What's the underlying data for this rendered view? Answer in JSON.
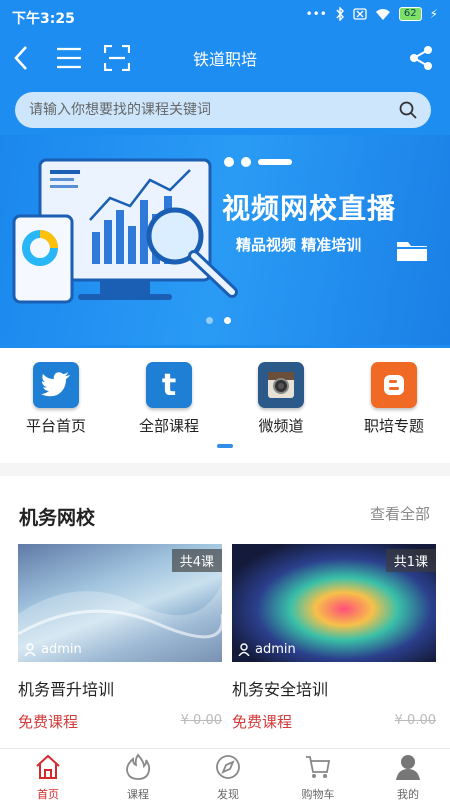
{
  "status": {
    "time": "下午3:25",
    "battery": "62"
  },
  "header": {
    "title": "铁道职培"
  },
  "search": {
    "placeholder": "请输入你想要找的课程关键词"
  },
  "banner": {
    "headline": "视频网校直播",
    "subline": "精品视频 精准培训"
  },
  "categories": [
    {
      "label": "平台首页",
      "icon": "twitter-icon",
      "color": "#1f7fd4"
    },
    {
      "label": "全部课程",
      "icon": "tumblr-icon",
      "color": "#1f7fd4"
    },
    {
      "label": "微频道",
      "icon": "instagram-icon",
      "color": "#2b5a8a"
    },
    {
      "label": "职培专题",
      "icon": "blogger-icon",
      "color": "#f06a26"
    }
  ],
  "section": {
    "title": "机务网校",
    "more": "查看全部",
    "courses": [
      {
        "badge": "共4课",
        "author": "admin",
        "name": "机务晋升培训",
        "price": "免费课程",
        "orig_price": "¥ 0.00"
      },
      {
        "badge": "共1课",
        "author": "admin",
        "name": "机务安全培训",
        "price": "免费课程",
        "orig_price": "¥ 0.00"
      }
    ]
  },
  "tabs": [
    {
      "label": "首页",
      "icon": "home-icon",
      "active": true
    },
    {
      "label": "课程",
      "icon": "flame-icon",
      "active": false
    },
    {
      "label": "发现",
      "icon": "compass-icon",
      "active": false
    },
    {
      "label": "购物车",
      "icon": "cart-icon",
      "active": false
    },
    {
      "label": "我的",
      "icon": "user-icon",
      "active": false
    }
  ],
  "colors": {
    "primary": "#1e8df2",
    "accent_red": "#d42a2a",
    "free_red": "#d43b3b"
  }
}
